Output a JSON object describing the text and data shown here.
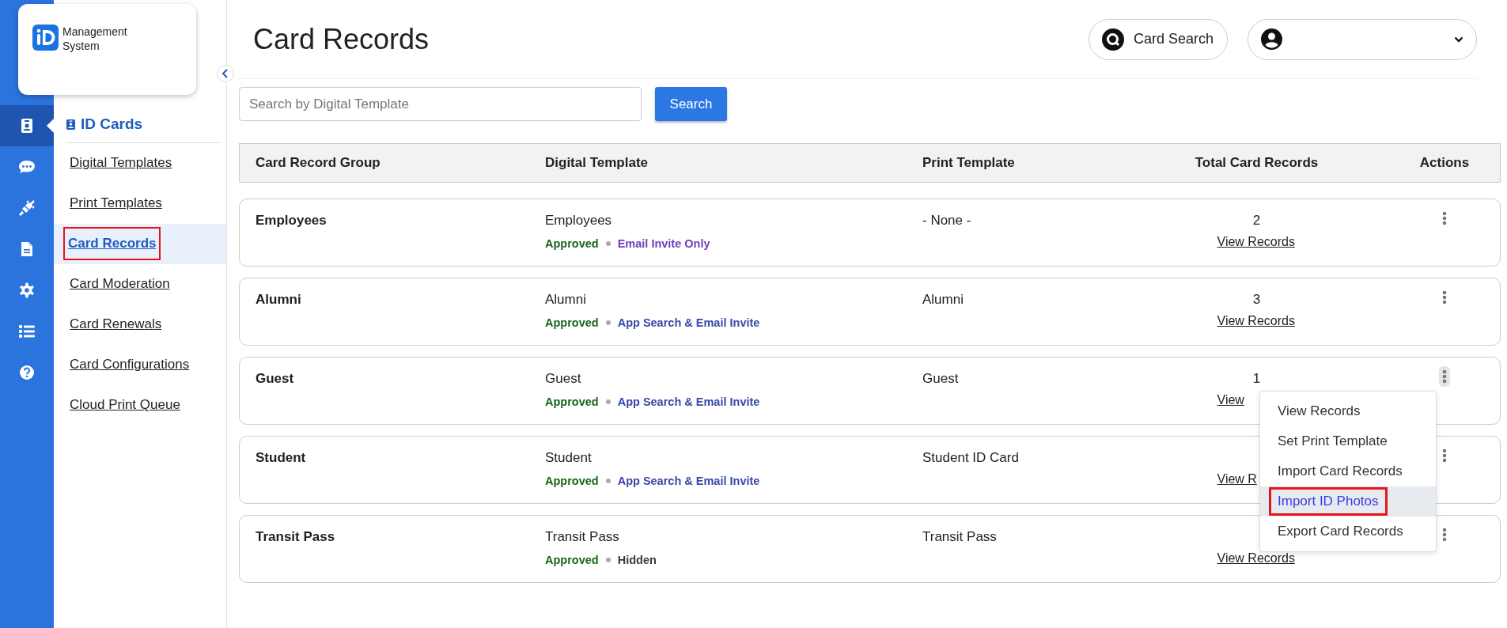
{
  "logo": {
    "lines": [
      "Management",
      "System"
    ]
  },
  "rail": [
    {
      "kind": "id-card",
      "selected": true
    },
    {
      "kind": "chat",
      "selected": false
    },
    {
      "kind": "plug",
      "selected": false
    },
    {
      "kind": "invoice",
      "selected": false
    },
    {
      "kind": "settings",
      "selected": false
    },
    {
      "kind": "list",
      "selected": false
    },
    {
      "kind": "help",
      "selected": false
    }
  ],
  "section": {
    "title": "ID Cards"
  },
  "nav": [
    {
      "label": "Digital Templates",
      "selected": false,
      "outlined": false
    },
    {
      "label": "Print Templates",
      "selected": false,
      "outlined": false
    },
    {
      "label": "Card Records",
      "selected": true,
      "outlined": true
    },
    {
      "label": "Card Moderation",
      "selected": false,
      "outlined": false
    },
    {
      "label": "Card Renewals",
      "selected": false,
      "outlined": false
    },
    {
      "label": "Card Configurations",
      "selected": false,
      "outlined": false
    },
    {
      "label": "Cloud Print Queue",
      "selected": false,
      "outlined": false
    }
  ],
  "page_title": "Card Records",
  "card_search": {
    "label": "Card Search"
  },
  "search": {
    "placeholder": "Search by Digital Template",
    "button": "Search"
  },
  "table": {
    "columns": [
      "Card Record Group",
      "Digital Template",
      "Print Template",
      "Total Card Records",
      "Actions"
    ],
    "rows": [
      {
        "group": "Employees",
        "digital_template": "Employees",
        "approval": "Approved",
        "visibility": {
          "label": "Email Invite Only",
          "color": "#6f3fbf"
        },
        "print_template": "- None -",
        "total": "2",
        "link": "View Records",
        "menu_open": false
      },
      {
        "group": "Alumni",
        "digital_template": "Alumni",
        "approval": "Approved",
        "visibility": {
          "label": "App Search & Email Invite",
          "color": "#3848a8"
        },
        "print_template": "Alumni",
        "total": "3",
        "link": "View Records",
        "menu_open": false
      },
      {
        "group": "Guest",
        "digital_template": "Guest",
        "approval": "Approved",
        "visibility": {
          "label": "App Search & Email Invite",
          "color": "#3848a8"
        },
        "print_template": "Guest",
        "total": "1",
        "link": "View",
        "menu_open": true
      },
      {
        "group": "Student",
        "digital_template": "Student",
        "approval": "Approved",
        "visibility": {
          "label": "App Search & Email Invite",
          "color": "#3848a8"
        },
        "print_template": "Student ID Card",
        "link": "View R",
        "menu_open": false
      },
      {
        "group": "Transit Pass",
        "digital_template": "Transit Pass",
        "approval": "Approved",
        "visibility": {
          "label": "Hidden",
          "color": "#3a3a3a"
        },
        "print_template": "Transit Pass",
        "link": "View Records",
        "menu_open": false
      }
    ]
  },
  "action_menu": {
    "items": [
      {
        "label": "View Records",
        "hovered": false,
        "outlined": false
      },
      {
        "label": "Set Print Template",
        "hovered": false,
        "outlined": false
      },
      {
        "label": "Import Card Records",
        "hovered": false,
        "outlined": false
      },
      {
        "label": "Import ID Photos",
        "hovered": true,
        "outlined": true
      },
      {
        "label": "Export Card Records",
        "hovered": false,
        "outlined": false
      }
    ]
  }
}
